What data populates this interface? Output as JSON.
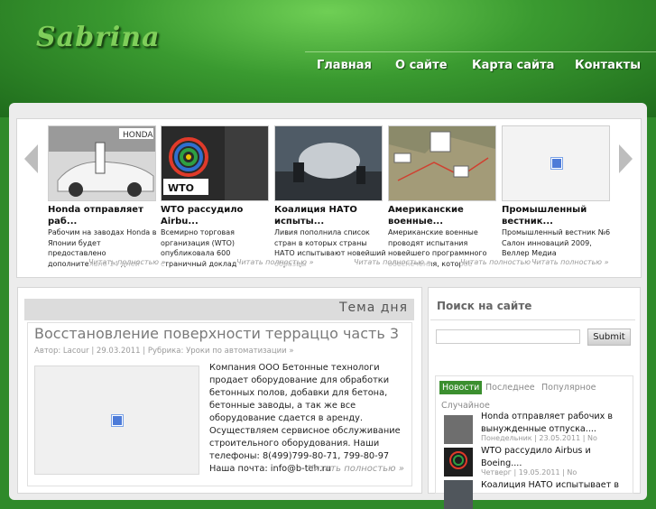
{
  "site": {
    "logo": "Sabrina"
  },
  "nav": [
    "Главная",
    "О сайте",
    "Карта сайта",
    "Контакты"
  ],
  "slider": {
    "prev_label": "‹",
    "next_label": "›",
    "slides": [
      {
        "title": "Honda отправляет раб...",
        "desc": "Рабочим на заводах Honda в Японии будет предоставлено дополнительно 14 дней",
        "more": "Читать полностью »"
      },
      {
        "title": "WTO рассудило Airbu...",
        "desc": "Всемирно торговая организация (WTO) опубликовала 600 страничный доклад",
        "more": "Читать полностью »"
      },
      {
        "title": "Коалиция НАТО испыты...",
        "desc": "Ливия пополнила список стран в которых страны НАТО испытывают новейший образцы",
        "more": "Читать полностью »"
      },
      {
        "title": "Американские военные...",
        "desc": "Американские военные проводят испытания новейшего программного обеспечения, которое",
        "more": "Читать полностью »"
      },
      {
        "title": "Промышленный вестник...",
        "desc": "Промышленный вестник №6 Салон инноваций 2009, Веллер Медиа",
        "more": "Читать полностью »"
      }
    ]
  },
  "featured": {
    "section_label": "Тема дня",
    "title": "Восстановление поверхности терраццо часть 3",
    "meta": "Автор: Lacour | 29.03.2011 | Рубрика: Уроки по автоматизации »",
    "text": "Компания ООО Бетонные технологи продает оборудование для обработки бетонных полов, добавки для бетона, бетонные заводы, а так же все оборудование сдается в аренду. Осуществляем сервисное обслуживание строительного оборудования. Наши телефоны: 8(499)799-80-71, 799-80-97 Наша почта: info@b-teh.ru",
    "more": "Читать полностью »"
  },
  "sidebar": {
    "search_title": "Поиск на сайте",
    "search_value": "",
    "submit_label": "Submit",
    "tabs": [
      "Новости",
      "Последнее",
      "Популярное",
      "Случайное"
    ],
    "news": [
      {
        "title": "Honda отправляет рабочих в вынужденные отпуска....",
        "meta": "Понедельник | 23.05.2011 | No"
      },
      {
        "title": "WTO рассудило Airbus и Boeing....",
        "meta": "Четверг | 19.05.2011 | No"
      },
      {
        "title": "Коалиция НАТО испытывает в",
        "meta": ""
      }
    ]
  },
  "colors": {
    "brand_green": "#3b8f2f",
    "header_green": "#3a9a30",
    "panel_bg": "#ececec"
  }
}
